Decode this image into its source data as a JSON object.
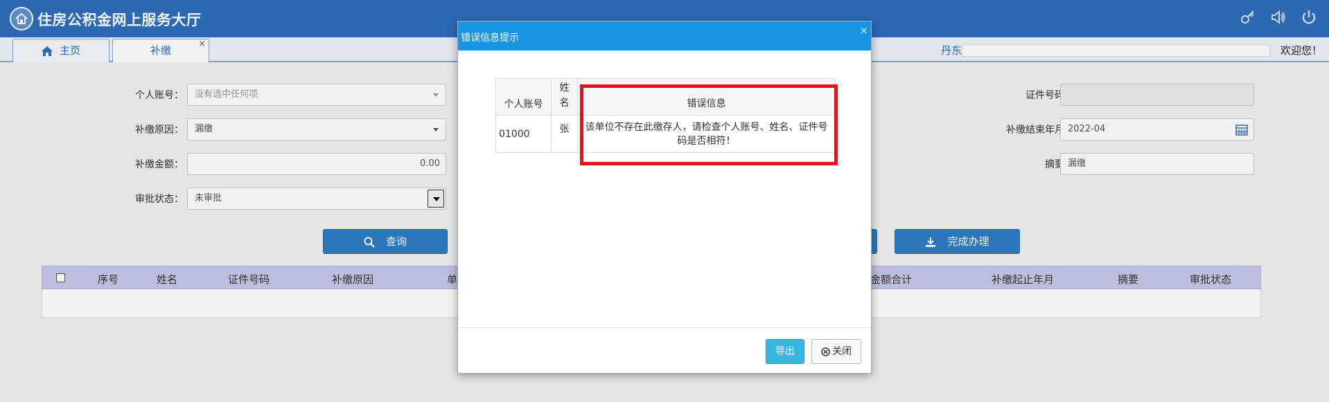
{
  "header": {
    "title": "住房公积金网上服务大厅",
    "icons": [
      "key-icon",
      "speaker-icon",
      "power-icon"
    ]
  },
  "tabs": [
    {
      "label": "主页",
      "icon": "home-icon"
    },
    {
      "label": "补缴",
      "close": "×"
    }
  ],
  "user": {
    "name": "丹东",
    "welcome": "欢迎您！"
  },
  "form": {
    "personal_account": {
      "label": "个人账号：",
      "placeholder": "没有选中任何项"
    },
    "reason": {
      "label": "补缴原因：",
      "value": "漏缴"
    },
    "amount": {
      "label": "补缴金额：",
      "value": "0.00"
    },
    "approval": {
      "label": "审批状态：",
      "value": "未审批"
    },
    "id_number": {
      "label": "证件号码：",
      "value": ""
    },
    "end_month": {
      "label": "补缴结束年月：",
      "value": "2022-04"
    },
    "summary": {
      "label": "摘要：",
      "value": "漏缴"
    }
  },
  "buttons": {
    "query": "查询",
    "complete": "完成办理"
  },
  "grid": {
    "columns": [
      "序号",
      "姓名",
      "证件号码",
      "补缴原因",
      "单",
      "金额合计",
      "补缴起止年月",
      "摘要",
      "审批状态"
    ]
  },
  "modal": {
    "title": "错误信息提示",
    "close": "×",
    "table": {
      "headers": [
        "个人账号",
        "姓名",
        "错误信息"
      ],
      "rows": [
        {
          "account": "01000",
          "name": "张",
          "message": "该单位不存在此缴存人，请检查个人账号、姓名、证件号码是否相符！"
        }
      ]
    },
    "export": "导出",
    "close_button": "关闭"
  }
}
